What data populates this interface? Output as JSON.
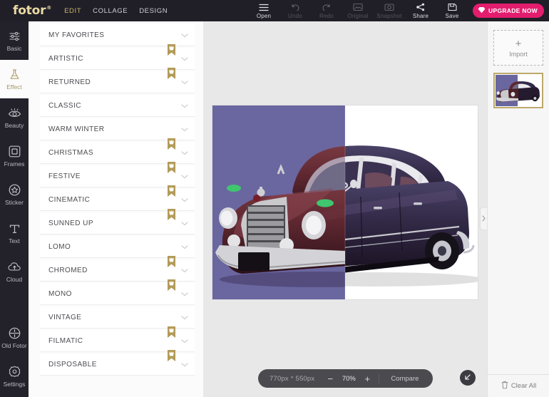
{
  "brand": {
    "name": "fotor",
    "reg": "®"
  },
  "topnav": [
    {
      "label": "EDIT",
      "active": true
    },
    {
      "label": "COLLAGE",
      "active": false
    },
    {
      "label": "DESIGN",
      "active": false
    }
  ],
  "tools": [
    {
      "label": "Open",
      "icon": "menu-icon",
      "enabled": true
    },
    {
      "label": "Undo",
      "icon": "undo-icon",
      "enabled": false
    },
    {
      "label": "Redo",
      "icon": "redo-icon",
      "enabled": false
    },
    {
      "label": "Original",
      "icon": "original-image-icon",
      "enabled": false
    },
    {
      "label": "Snapshot",
      "icon": "camera-icon",
      "enabled": false
    },
    {
      "label": "Share",
      "icon": "share-icon",
      "enabled": true
    },
    {
      "label": "Save",
      "icon": "save-disk-icon",
      "enabled": true
    }
  ],
  "upgrade": {
    "label": "UPGRADE NOW",
    "icon": "diamond-icon",
    "color": "#e31d6e"
  },
  "rail": {
    "items": [
      {
        "label": "Basic",
        "icon": "sliders-icon",
        "active": false
      },
      {
        "label": "Effect",
        "icon": "flask-icon",
        "active": true
      },
      {
        "label": "Beauty",
        "icon": "eye-icon",
        "active": false
      },
      {
        "label": "Frames",
        "icon": "frame-icon",
        "active": false
      },
      {
        "label": "Sticker",
        "icon": "star-badge-icon",
        "active": false
      },
      {
        "label": "Text",
        "icon": "text-t-icon",
        "active": false
      },
      {
        "label": "Cloud",
        "icon": "cloud-up-icon",
        "active": false
      }
    ],
    "bottom": [
      {
        "label": "Old Fotor",
        "icon": "old-fotor-icon",
        "active": false
      },
      {
        "label": "Settings",
        "icon": "gear-icon",
        "active": false
      }
    ]
  },
  "effects": {
    "groups": [
      {
        "label": "MY FAVORITES",
        "premium": false
      },
      {
        "label": "ARTISTIC",
        "premium": true
      },
      {
        "label": "RETURNED",
        "premium": true
      },
      {
        "label": "CLASSIC",
        "premium": false
      },
      {
        "label": "WARM WINTER",
        "premium": false
      },
      {
        "label": "CHRISTMAS",
        "premium": true
      },
      {
        "label": "FESTIVE",
        "premium": true
      },
      {
        "label": "CINEMATIC",
        "premium": true
      },
      {
        "label": "SUNNED UP",
        "premium": true
      },
      {
        "label": "LOMO",
        "premium": false
      },
      {
        "label": "CHROMED",
        "premium": true
      },
      {
        "label": "MONO",
        "premium": true
      },
      {
        "label": "VINTAGE",
        "premium": false
      },
      {
        "label": "FILMATIC",
        "premium": true
      },
      {
        "label": "DISPOSABLE",
        "premium": true
      }
    ]
  },
  "canvas": {
    "image_alt": "vintage-mercedes-sedan-photo",
    "filtered_background": "#6a66a0",
    "original_background": "#ffffff",
    "collapse_handle_icon": "chevron-right-icon"
  },
  "zoombar": {
    "dimensions": "770px * 550px",
    "zoom_out_label": "−",
    "zoom_level": "70%",
    "zoom_in_label": "+",
    "compare_label": "Compare"
  },
  "fit_button": {
    "icon": "arrow-up-left-icon"
  },
  "right_panel": {
    "import_label": "Import",
    "import_plus": "+",
    "thumbnail_alt": "photo-thumbnail",
    "clear_all_label": "Clear All",
    "clear_all_icon": "trash-icon"
  }
}
